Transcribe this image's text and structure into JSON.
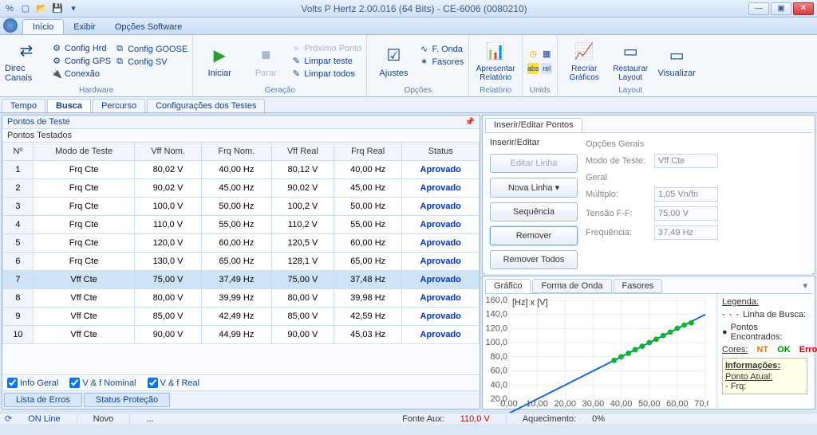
{
  "window": {
    "title": "Volts P Hertz 2.00.016 (64 Bits) - CE-6006 (0080210)"
  },
  "menu": {
    "inicio": "Início",
    "exibir": "Exibir",
    "opcoes": "Opções Software"
  },
  "ribbon": {
    "hardware": {
      "label": "Hardware",
      "direc": "Direc Canais",
      "cfgHrd": "Config Hrd",
      "cfgGoose": "Config GOOSE",
      "cfgGps": "Config GPS",
      "cfgSv": "Config SV",
      "conexao": "Conexão"
    },
    "ger": {
      "label": "Geração",
      "iniciar": "Iniciar",
      "parar": "Parar",
      "prox": "Próximo Ponto",
      "limparT": "Limpar teste",
      "limparA": "Limpar todos"
    },
    "op": {
      "label": "Opções",
      "ajustes": "Ajustes",
      "fonda": "F. Onda",
      "fasores": "Fasores"
    },
    "rel": {
      "label": "Relatório",
      "apresentar": "Apresentar Relatório"
    },
    "unids": {
      "label": "Unids"
    },
    "layout": {
      "label": "Layout",
      "recriar": "Recriar Gráficos",
      "restaurar": "Restaurar Layout",
      "visualizar": "Visualizar"
    }
  },
  "subtabs": {
    "tempo": "Tempo",
    "busca": "Busca",
    "percurso": "Percurso",
    "config": "Configurações dos Testes"
  },
  "left": {
    "hdr": "Pontos de Teste",
    "sub": "Pontos Testados",
    "cols": {
      "n": "Nº",
      "modo": "Modo de Teste",
      "vffn": "Vff Nom.",
      "frqn": "Frq Nom.",
      "vffr": "Vff Real",
      "frqr": "Frq Real",
      "status": "Status"
    },
    "chk": {
      "info": "Info Geral",
      "vfn": "V & f Nominal",
      "vfr": "V & f Real"
    },
    "btabs": {
      "erros": "Lista de Erros",
      "status": "Status Proteção"
    }
  },
  "rows": [
    {
      "n": "1",
      "modo": "Frq Cte",
      "vffn": "80,02 V",
      "frqn": "40,00 Hz",
      "vffr": "80,12 V",
      "frqr": "40,00 Hz",
      "status": "Aprovado"
    },
    {
      "n": "2",
      "modo": "Frq Cte",
      "vffn": "90,02 V",
      "frqn": "45,00 Hz",
      "vffr": "90,02 V",
      "frqr": "45,00 Hz",
      "status": "Aprovado"
    },
    {
      "n": "3",
      "modo": "Frq Cte",
      "vffn": "100,0 V",
      "frqn": "50,00 Hz",
      "vffr": "100,2 V",
      "frqr": "50,00 Hz",
      "status": "Aprovado"
    },
    {
      "n": "4",
      "modo": "Frq Cte",
      "vffn": "110,0 V",
      "frqn": "55,00 Hz",
      "vffr": "110,2 V",
      "frqr": "55,00 Hz",
      "status": "Aprovado"
    },
    {
      "n": "5",
      "modo": "Frq Cte",
      "vffn": "120,0 V",
      "frqn": "60,00 Hz",
      "vffr": "120,5 V",
      "frqr": "60,00 Hz",
      "status": "Aprovado"
    },
    {
      "n": "6",
      "modo": "Frq Cte",
      "vffn": "130,0 V",
      "frqn": "65,00 Hz",
      "vffr": "128,1 V",
      "frqr": "65,00 Hz",
      "status": "Aprovado"
    },
    {
      "n": "7",
      "modo": "Vff Cte",
      "vffn": "75,00 V",
      "frqn": "37,49 Hz",
      "vffr": "75,00 V",
      "frqr": "37,48 Hz",
      "status": "Aprovado",
      "sel": true
    },
    {
      "n": "8",
      "modo": "Vff Cte",
      "vffn": "80,00 V",
      "frqn": "39,99 Hz",
      "vffr": "80,00 V",
      "frqr": "39,98 Hz",
      "status": "Aprovado"
    },
    {
      "n": "9",
      "modo": "Vff Cte",
      "vffn": "85,00 V",
      "frqn": "42,49 Hz",
      "vffr": "85,00 V",
      "frqr": "42,59 Hz",
      "status": "Aprovado"
    },
    {
      "n": "10",
      "modo": "Vff Cte",
      "vffn": "90,00 V",
      "frqn": "44,99 Hz",
      "vffr": "90,00 V",
      "frqr": "45,03 Hz",
      "status": "Aprovado"
    }
  ],
  "edit": {
    "tab": "Inserir/Editar Pontos",
    "hdr": "Inserir/Editar",
    "geral": "Opções Gerais",
    "editarLinha": "Editar Linha",
    "novaLinha": "Nova Linha",
    "seq": "Sequência",
    "remover": "Remover",
    "removerTodos": "Remover Todos",
    "modoTeste": "Modo de Teste:",
    "modoVal": "Vff Cte",
    "geralg": "Geral",
    "multiplo": "Múltiplo:",
    "multVal": "1,05 Vn/fn",
    "tensao": "Tensão F-F:",
    "tensaoVal": "75,00 V",
    "freq": "Frequência:",
    "freqVal": "37,49 Hz"
  },
  "chart": {
    "tabs": {
      "grafico": "Gráfico",
      "onda": "Forma de Onda",
      "fasores": "Fasores"
    },
    "axis": "[Hz] x [V]",
    "legend": {
      "h": "Legenda:",
      "linha": "Linha de Busca:",
      "pontos": "Pontos Encontrados:",
      "cores": "Cores:",
      "nt": "NT",
      "ok": "OK",
      "erro": "Erro:",
      "info": "Informações:",
      "patual": "Ponto Atual:",
      "frq": "- Frq:"
    }
  },
  "chart_data": {
    "type": "scatter",
    "title": "[Hz] x [V]",
    "xlabel": "Hz",
    "ylabel": "V",
    "xlim": [
      0,
      70
    ],
    "ylim": [
      20,
      160
    ],
    "yticks": [
      20,
      40,
      60,
      80,
      100,
      120,
      140,
      160
    ],
    "xticks": [
      0,
      10,
      20,
      30,
      40,
      50,
      60,
      70
    ],
    "series": [
      {
        "name": "Linha de Busca",
        "type": "line",
        "x": [
          0,
          70
        ],
        "y": [
          0,
          140
        ]
      },
      {
        "name": "Pontos Encontrados",
        "type": "scatter",
        "color": "#00c000",
        "x": [
          37.48,
          39.98,
          40.0,
          42.59,
          45.0,
          45.03,
          47.5,
          50.0,
          52.5,
          55.0,
          57.5,
          60.0,
          62.5,
          65.0
        ],
        "y": [
          75.0,
          80.0,
          80.12,
          85.0,
          90.02,
          90.0,
          95.0,
          100.2,
          105.0,
          110.2,
          115.0,
          120.5,
          125.0,
          128.1
        ]
      }
    ]
  },
  "status": {
    "online": "ON Line",
    "novo": "Novo",
    "dots": "...",
    "fonte": "Fonte Aux:",
    "fonteVal": "110,0 V",
    "aquec": "Aquecimento:",
    "aquecVal": "0%"
  }
}
